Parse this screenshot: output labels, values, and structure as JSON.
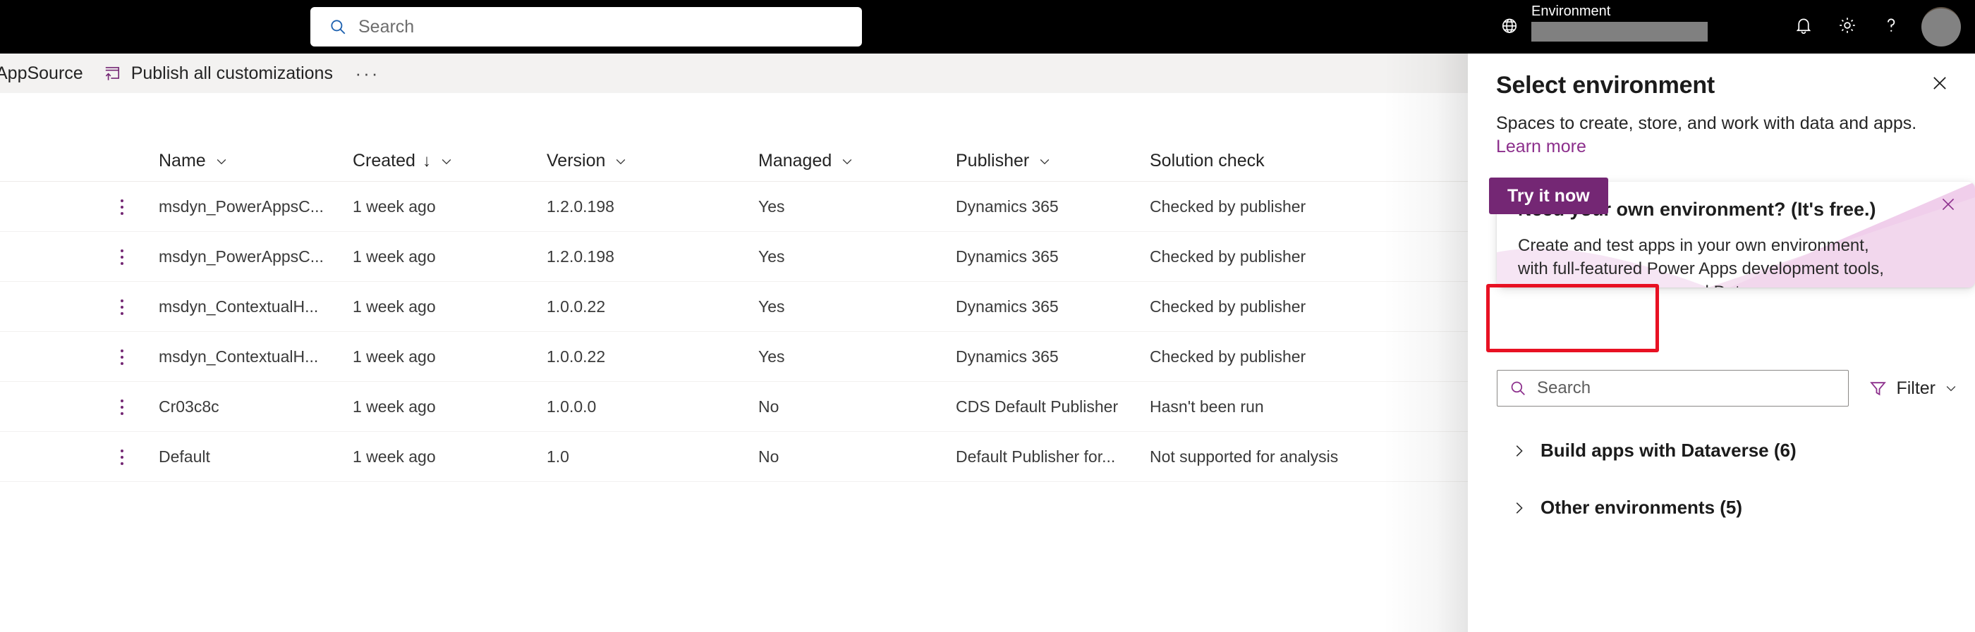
{
  "header": {
    "search": {
      "placeholder": "Search",
      "icon": "search-icon"
    },
    "environment_label": "Environment",
    "environment_value": "",
    "icons": {
      "globe": "globe-icon",
      "notifications": "bell-icon",
      "settings": "gear-icon",
      "help": "question-mark-icon",
      "account": "avatar"
    }
  },
  "command_bar": {
    "items": [
      {
        "label": "AppSource",
        "icon": ""
      },
      {
        "label": "Publish all customizations",
        "icon": "publish-icon"
      }
    ],
    "overflow_label": "···"
  },
  "grid": {
    "columns": [
      {
        "label": "Name",
        "sortable": true,
        "sorted": false
      },
      {
        "label": "Created",
        "sortable": true,
        "sorted": true,
        "sort_direction": "descending"
      },
      {
        "label": "Version",
        "sortable": true,
        "sorted": false
      },
      {
        "label": "Managed",
        "sortable": true,
        "sorted": false
      },
      {
        "label": "Publisher",
        "sortable": true,
        "sorted": false
      },
      {
        "label": "Solution check",
        "sortable": false,
        "sorted": false
      }
    ],
    "rows": [
      {
        "name": "msdyn_PowerAppsC...",
        "created": "1 week ago",
        "version": "1.2.0.198",
        "managed": "Yes",
        "publisher": "Dynamics 365",
        "solution_check": "Checked by publisher"
      },
      {
        "name": "msdyn_PowerAppsC...",
        "created": "1 week ago",
        "version": "1.2.0.198",
        "managed": "Yes",
        "publisher": "Dynamics 365",
        "solution_check": "Checked by publisher"
      },
      {
        "name": "msdyn_ContextualH...",
        "created": "1 week ago",
        "version": "1.0.0.22",
        "managed": "Yes",
        "publisher": "Dynamics 365",
        "solution_check": "Checked by publisher"
      },
      {
        "name": "msdyn_ContextualH...",
        "created": "1 week ago",
        "version": "1.0.0.22",
        "managed": "Yes",
        "publisher": "Dynamics 365",
        "solution_check": "Checked by publisher"
      },
      {
        "name": "Cr03c8c",
        "created": "1 week ago",
        "version": "1.0.0.0",
        "managed": "No",
        "publisher": "CDS Default Publisher",
        "solution_check": "Hasn't been run"
      },
      {
        "name": "Default",
        "created": "1 week ago",
        "version": "1.0",
        "managed": "No",
        "publisher": "Default Publisher for...",
        "solution_check": "Not supported for analysis"
      }
    ]
  },
  "panel": {
    "title": "Select environment",
    "subtitle": "Spaces to create, store, and work with data and apps.",
    "learn_more": "Learn more",
    "close_label": "✕",
    "callout": {
      "heading": "Need your own environment? (It's free.)",
      "body": "Create and test apps in your own environment, with full-featured Power Apps development tools, premium connectors, and Dataverse.",
      "button": "Try it now",
      "close_label": "✕",
      "button_color": "#742774",
      "art_color": "#e9bfe4"
    },
    "search": {
      "placeholder": "Search",
      "icon": "search-icon"
    },
    "filter": {
      "label": "Filter",
      "icon": "filter-icon"
    },
    "groups": [
      {
        "label": "Build apps with Dataverse (6)",
        "expanded": false
      },
      {
        "label": "Other environments (5)",
        "expanded": false
      }
    ]
  },
  "annotation": {
    "highlight_color": "#e81123",
    "target": "try-it-now-button"
  }
}
